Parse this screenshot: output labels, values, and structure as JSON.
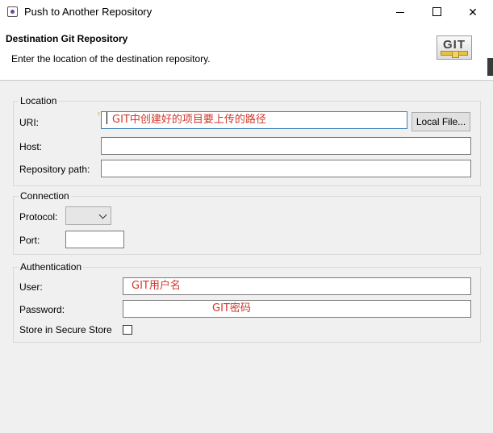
{
  "window": {
    "title": "Push to Another Repository",
    "minimize_icon": "minimize-icon",
    "maximize_icon": "maximize-icon",
    "close_icon": "close-icon",
    "close_glyph": "✕"
  },
  "banner": {
    "title": "Destination Git Repository",
    "description": "Enter the location of the destination repository.",
    "logo_text": "GIT"
  },
  "location": {
    "group_title": "Location",
    "uri_label": "URI:",
    "uri_value": "GIT中创建好的项目要上传的路径",
    "local_file_button": "Local File...",
    "host_label": "Host:",
    "host_value": "",
    "repo_path_label": "Repository path:",
    "repo_path_value": ""
  },
  "connection": {
    "group_title": "Connection",
    "protocol_label": "Protocol:",
    "protocol_value": "",
    "port_label": "Port:",
    "port_value": ""
  },
  "authentication": {
    "group_title": "Authentication",
    "user_label": "User:",
    "user_value": "GIT用户名",
    "password_label": "Password:",
    "password_value": "GIT密码",
    "store_label": "Store in Secure Store",
    "store_checked": false
  },
  "colors": {
    "annotation_red": "#d0362a",
    "dialog_bg": "#f0f0f0"
  }
}
